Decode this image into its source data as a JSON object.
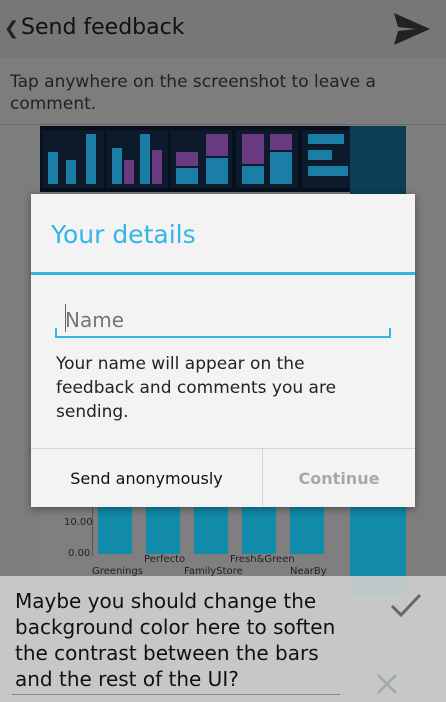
{
  "action_bar": {
    "title": "Send feedback",
    "back_icon": "chevron-left-icon",
    "send_icon": "send-icon"
  },
  "instruction": "Tap anywhere on the screenshot to leave a comment.",
  "preview": {
    "y_ticks": [
      "10.00",
      "0.00"
    ],
    "x_labels": [
      "Greenings",
      "Perfecto",
      "FamilyStore",
      "Fresh&Green",
      "NearBy"
    ]
  },
  "dialog": {
    "title": "Your details",
    "name_placeholder": "Name",
    "name_value": "",
    "help": "Your name will appear on the feedback and comments you are sending.",
    "anonymous_label": "Send anonymously",
    "continue_label": "Continue"
  },
  "comment": {
    "text": "Maybe you should change the background color here to soften the contrast between the bars and the rest of the UI?",
    "confirm_icon": "check-icon",
    "discard_icon": "close-icon"
  },
  "colors": {
    "accent": "#33b5e5",
    "bar": "#1b7ea6",
    "bar_purple": "#6a3b80"
  }
}
